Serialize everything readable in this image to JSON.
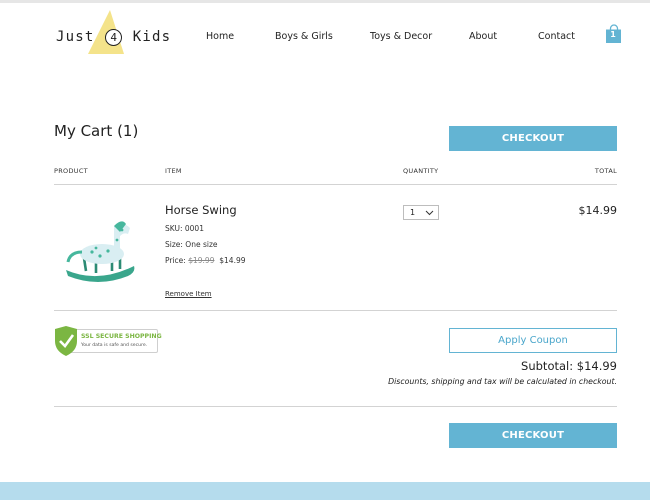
{
  "header": {
    "logo": {
      "part1": "Just",
      "digit": "4",
      "part2": "Kids"
    },
    "nav": [
      "Home",
      "Boys & Girls",
      "Toys & Decor",
      "About",
      "Contact"
    ],
    "cart_count": "1"
  },
  "cart": {
    "title": "My Cart (1)",
    "checkout_label": "CHECKOUT",
    "columns": {
      "product": "PRODUCT",
      "item": "ITEM",
      "quantity": "QUANTITY",
      "total": "TOTAL"
    },
    "items": [
      {
        "name": "Horse Swing",
        "sku": "SKU: 0001",
        "size": "Size: One size",
        "price_label": "Price:",
        "original_price": "$19.99",
        "price": "$14.99",
        "quantity": "1",
        "total": "$14.99",
        "remove_label": "Remove Item"
      }
    ],
    "ssl_badge": {
      "title": "SSL SECURE SHOPPING",
      "subtitle": "Your data is safe and secure."
    },
    "coupon_label": "Apply Coupon",
    "subtotal": "Subtotal: $14.99",
    "disclaimer": "Discounts, shipping and tax will be calculated in checkout."
  },
  "colors": {
    "accent": "#63b4d3",
    "logo_triangle": "#f4e38a",
    "footer": "#b5dced",
    "ssl_green": "#7bb642"
  },
  "icons": {
    "cart": "shopping-bag-icon",
    "quantity": "chevron-down-icon",
    "ssl": "shield-check-icon"
  }
}
